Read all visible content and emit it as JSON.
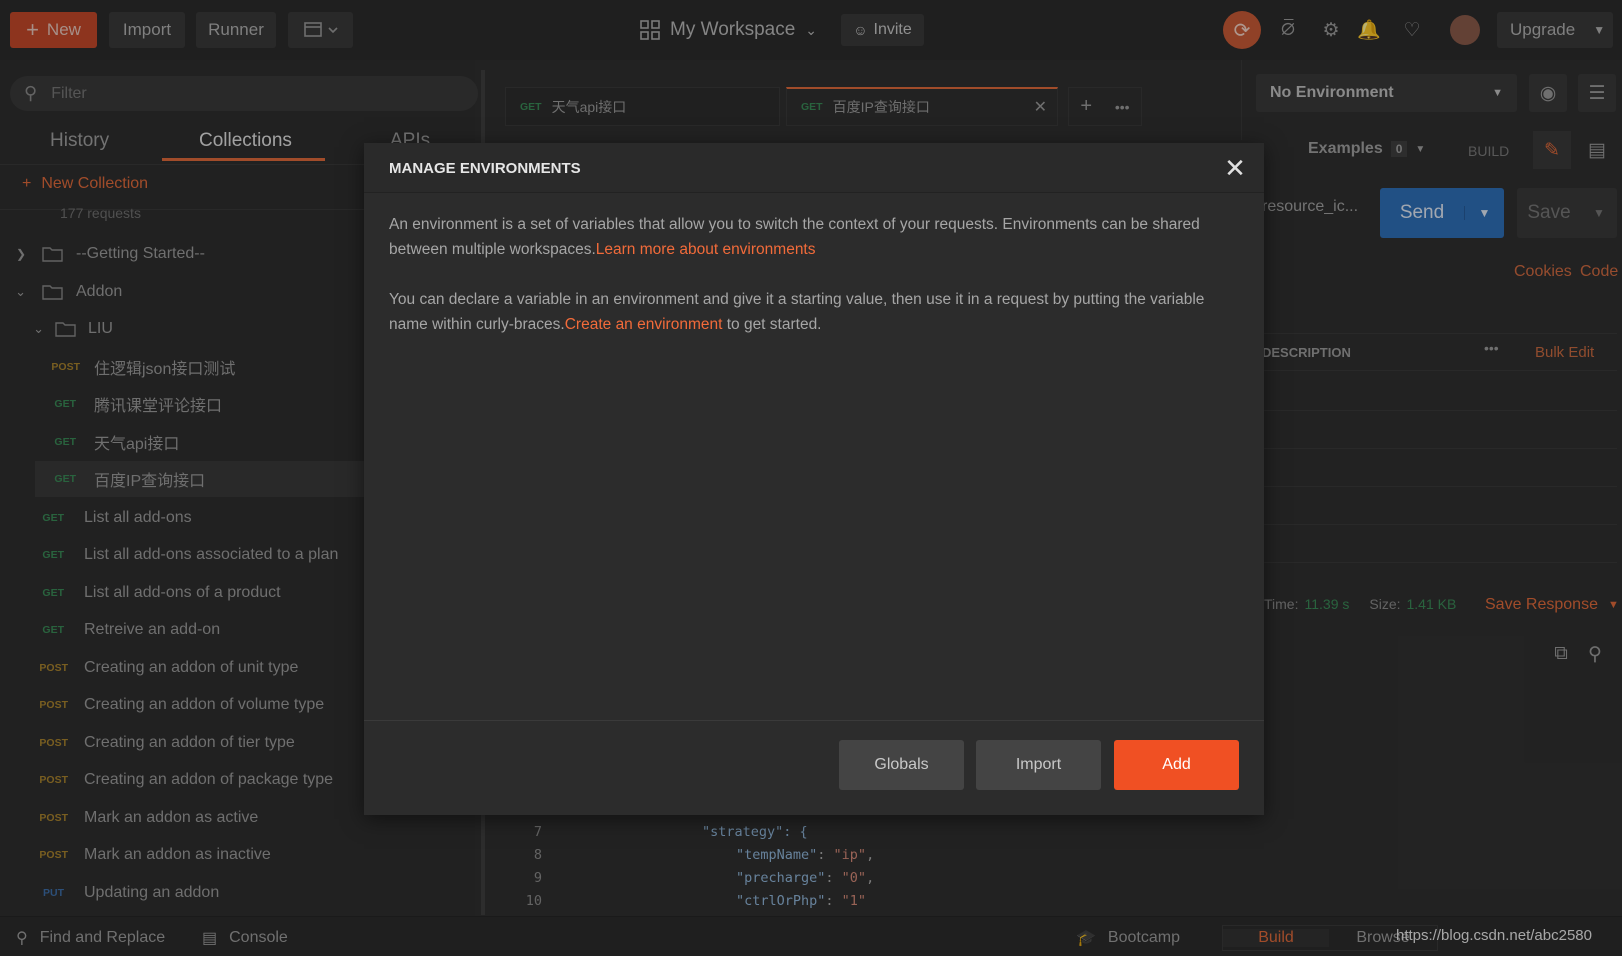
{
  "topbar": {
    "new_label": "New",
    "import_label": "Import",
    "runner_label": "Runner",
    "workspace": "My Workspace",
    "invite": "Invite",
    "upgrade": "Upgrade"
  },
  "sidebar": {
    "filter_placeholder": "Filter",
    "tabs": [
      "History",
      "Collections",
      "APIs"
    ],
    "new_collection": "New Collection",
    "requests_count": "177 requests",
    "folders": {
      "getting_started": "--Getting Started--",
      "addon": "Addon",
      "liu": "LIU"
    },
    "liu_items": [
      {
        "method": "POST",
        "name": "住逻辑json接口测试"
      },
      {
        "method": "GET",
        "name": "腾讯课堂评论接口"
      },
      {
        "method": "GET",
        "name": "天气api接口"
      },
      {
        "method": "GET",
        "name": "百度IP查询接口"
      }
    ],
    "addon_items": [
      {
        "method": "GET",
        "name": "List all add-ons"
      },
      {
        "method": "GET",
        "name": "List all add-ons associated to a plan"
      },
      {
        "method": "GET",
        "name": "List all add-ons of a product"
      },
      {
        "method": "GET",
        "name": "Retreive an add-on"
      },
      {
        "method": "POST",
        "name": "Creating an addon of unit type"
      },
      {
        "method": "POST",
        "name": "Creating an addon of volume type"
      },
      {
        "method": "POST",
        "name": "Creating an addon of tier type"
      },
      {
        "method": "POST",
        "name": "Creating an addon of package type"
      },
      {
        "method": "POST",
        "name": "Mark an addon as active"
      },
      {
        "method": "POST",
        "name": "Mark an addon as inactive"
      },
      {
        "method": "PUT",
        "name": "Updating an addon"
      }
    ]
  },
  "request_tabs": [
    {
      "method": "GET",
      "name": "天气api接口"
    },
    {
      "method": "GET",
      "name": "百度IP查询接口"
    }
  ],
  "right_panel": {
    "environment": "No Environment",
    "examples_label": "Examples",
    "examples_count": "0",
    "build_label": "BUILD",
    "url_fragment": "resource_ic...",
    "send": "Send",
    "save": "Save",
    "cookies": "Cookies",
    "code": "Code",
    "description_header": "DESCRIPTION",
    "bulk_edit": "Bulk Edit",
    "time_label": "Time:",
    "time_value": "11.39 s",
    "size_label": "Size:",
    "size_value": "1.41 KB",
    "save_response": "Save Response"
  },
  "code_lines": [
    {
      "num": "7",
      "text": "\"strategy\": {"
    },
    {
      "num": "8",
      "key": "\"tempName\"",
      "val": "\"ip\""
    },
    {
      "num": "9",
      "key": "\"precharge\"",
      "val": "\"0\""
    },
    {
      "num": "10",
      "key": "\"ctrlOrPhp\"",
      "val": "\"1\""
    }
  ],
  "modal": {
    "title": "MANAGE ENVIRONMENTS",
    "para1": "An environment is a set of variables that allow you to switch the context of your requests. Environments can be shared between multiple workspaces.",
    "para1_link": "Learn more about environments",
    "para2_start": "You can declare a variable in an environment and give it a starting value, then use it in a request by putting the variable name within curly-braces.",
    "para2_link": "Create an environment",
    "para2_end": " to get started.",
    "globals": "Globals",
    "import": "Import",
    "add": "Add"
  },
  "bottombar": {
    "find_replace": "Find and Replace",
    "console": "Console",
    "bootcamp": "Bootcamp",
    "build": "Build",
    "browse": "Browse",
    "watermark": "https://blog.csdn.net/abc2580"
  },
  "colors": {
    "accent": "#f26b3a",
    "add_button": "#f05023",
    "send_button": "#2f6fb8"
  }
}
